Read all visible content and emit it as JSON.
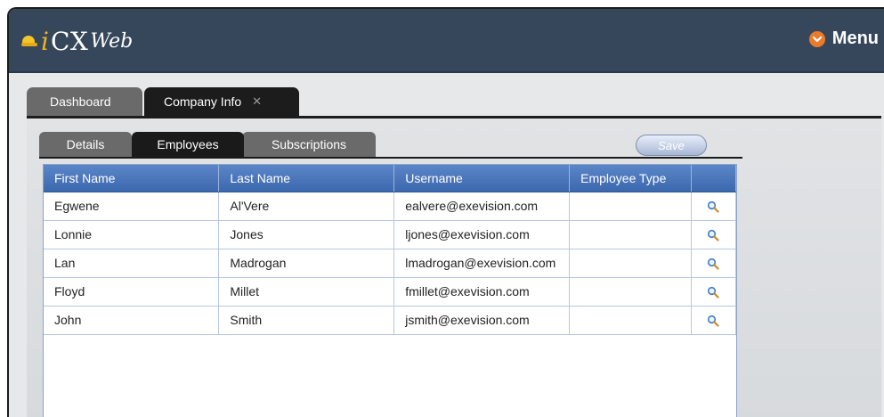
{
  "app": {
    "brand_i": "i",
    "brand_cx": "CX",
    "brand_web": "Web",
    "menu_label": "Menu"
  },
  "main_tabs": [
    {
      "label": "Dashboard",
      "active": false
    },
    {
      "label": "Company Info",
      "active": true,
      "closable": true
    }
  ],
  "sub_tabs": [
    {
      "label": "Details",
      "active": false
    },
    {
      "label": "Employees",
      "active": true
    },
    {
      "label": "Subscriptions",
      "active": false
    }
  ],
  "save_label": "Save",
  "table": {
    "columns": [
      "First Name",
      "Last Name",
      "Username",
      "Employee Type",
      ""
    ],
    "rows": [
      {
        "first": "Egwene",
        "last": "Al'Vere",
        "username": "ealvere@exevision.com",
        "type": ""
      },
      {
        "first": "Lonnie",
        "last": "Jones",
        "username": "ljones@exevision.com",
        "type": ""
      },
      {
        "first": "Lan",
        "last": "Madrogan",
        "username": "lmadrogan@exevision.com",
        "type": ""
      },
      {
        "first": "Floyd",
        "last": "Millet",
        "username": "fmillet@exevision.com",
        "type": ""
      },
      {
        "first": "John",
        "last": "Smith",
        "username": "jsmith@exevision.com",
        "type": ""
      }
    ]
  },
  "icons": {
    "logo": "hardhat-icon",
    "menu": "chevron-down-icon",
    "tab_close": "close-icon",
    "row_action": "zoom-icon"
  },
  "colors": {
    "header_bg": "#36475b",
    "logo_accent": "#f2b21a",
    "menu_accent": "#ec7a2b",
    "grid_header": "#4a76bb",
    "tab_active": "#1c1c1c",
    "tab_inactive": "#6a6a6a"
  }
}
